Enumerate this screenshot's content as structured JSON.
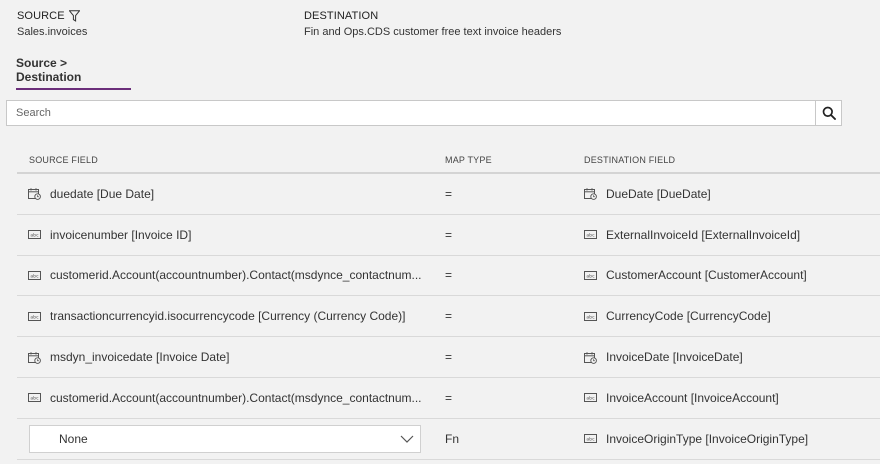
{
  "source": {
    "label": "SOURCE",
    "value": "Sales.invoices"
  },
  "destination": {
    "label": "DESTINATION",
    "value": "Fin and Ops.CDS customer free text invoice headers"
  },
  "tab": {
    "label": "Source > Destination"
  },
  "search": {
    "placeholder": "Search",
    "value": ""
  },
  "columns": {
    "source": "SOURCE FIELD",
    "map": "MAP TYPE",
    "destination": "DESTINATION FIELD"
  },
  "rows": [
    {
      "source_icon": "date-field-icon",
      "source": "duedate [Due Date]",
      "map": "=",
      "dest_icon": "date-field-icon",
      "destination": "DueDate [DueDate]"
    },
    {
      "source_icon": "text-field-icon",
      "source": "invoicenumber [Invoice ID]",
      "map": "=",
      "dest_icon": "text-field-icon",
      "destination": "ExternalInvoiceId [ExternalInvoiceId]"
    },
    {
      "source_icon": "text-field-icon",
      "source": "customerid.Account(accountnumber).Contact(msdynce_contactnum...",
      "map": "=",
      "dest_icon": "text-field-icon",
      "destination": "CustomerAccount [CustomerAccount]"
    },
    {
      "source_icon": "text-field-icon",
      "source": "transactioncurrencyid.isocurrencycode [Currency (Currency Code)]",
      "map": "=",
      "dest_icon": "text-field-icon",
      "destination": "CurrencyCode [CurrencyCode]"
    },
    {
      "source_icon": "date-field-icon",
      "source": "msdyn_invoicedate [Invoice Date]",
      "map": "=",
      "dest_icon": "date-field-icon",
      "destination": "InvoiceDate [InvoiceDate]"
    },
    {
      "source_icon": "text-field-icon",
      "source": "customerid.Account(accountnumber).Contact(msdynce_contactnum...",
      "map": "=",
      "dest_icon": "text-field-icon",
      "destination": "InvoiceAccount [InvoiceAccount]"
    },
    {
      "source_select": "None",
      "map": "Fn",
      "dest_icon": "text-field-icon",
      "destination": "InvoiceOriginType [InvoiceOriginType]"
    }
  ]
}
